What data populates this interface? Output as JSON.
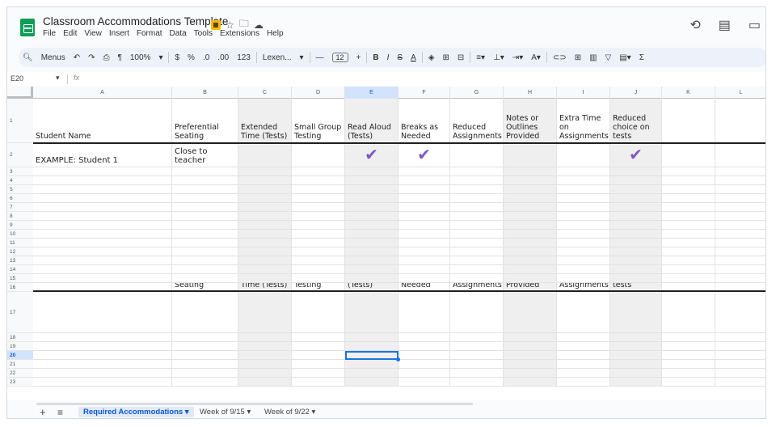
{
  "app": {
    "title": "Classroom Accommodations Template",
    "menu": [
      "File",
      "Edit",
      "View",
      "Insert",
      "Format",
      "Data",
      "Tools",
      "Extensions",
      "Help"
    ],
    "title_icons": [
      "label-icon",
      "star-icon",
      "folder-icon",
      "cloud-icon"
    ],
    "right_icons": [
      "history-icon",
      "comment-icon",
      "video-icon"
    ]
  },
  "toolbar": {
    "menus_label": "Menus",
    "zoom": "100%",
    "currency": "$",
    "percent": "%",
    "dec_less": ".0",
    "dec_more": ".00",
    "number_format": "123",
    "font": "Lexen...",
    "font_size": "12",
    "minus": "—",
    "plus": "+",
    "bold": "B",
    "italic": "I",
    "strike": "S",
    "text_color": "A",
    "sum": "Σ"
  },
  "formula": {
    "cell_ref": "E20",
    "fx": "fx",
    "value": ""
  },
  "columns": [
    "A",
    "B",
    "C",
    "D",
    "E",
    "F",
    "G",
    "H",
    "I",
    "J",
    "K",
    "L"
  ],
  "selected_column": "E",
  "selected_cell": "E20",
  "rows": [
    "1",
    "2",
    "3",
    "4",
    "5",
    "6",
    "7",
    "8",
    "9",
    "10",
    "11",
    "12",
    "13",
    "14",
    "15",
    "16",
    "17",
    "18",
    "19",
    "20",
    "21",
    "22",
    "23"
  ],
  "header_row": [
    "Student Name",
    "Preferential Seating",
    "Extended Time (Tests)",
    "Small Group Testing",
    "Read Aloud (Tests)",
    "Breaks as Needed",
    "Reduced Assignments",
    "Notes or Outlines Provided",
    "Extra Time on Assignments",
    "Reduced choice on tests"
  ],
  "header_row_16": [
    "",
    "Preferential Seating",
    "Extended Time (Tests)",
    "Small Group Testing",
    "Read Aloud (Tests)",
    "Breaks as Needed",
    "Reduced Assignments",
    "Notes or Outlines Provided",
    "Extra Time on Assignments",
    "Reduced choice on tests"
  ],
  "example_row": {
    "student": "EXAMPLE: Student 1",
    "seating": "Close to teacher",
    "checked_columns": [
      "E",
      "F",
      "J"
    ]
  },
  "colors": {
    "check": "#7e57c2",
    "selection": "#1a73e8",
    "active_tab": "#0b57d0",
    "gray_fill": "#efefef"
  },
  "sheets": [
    {
      "label": "Required Accommodations",
      "active": true
    },
    {
      "label": "Week of 9/15",
      "active": false
    },
    {
      "label": "Week of 9/22",
      "active": false
    }
  ]
}
